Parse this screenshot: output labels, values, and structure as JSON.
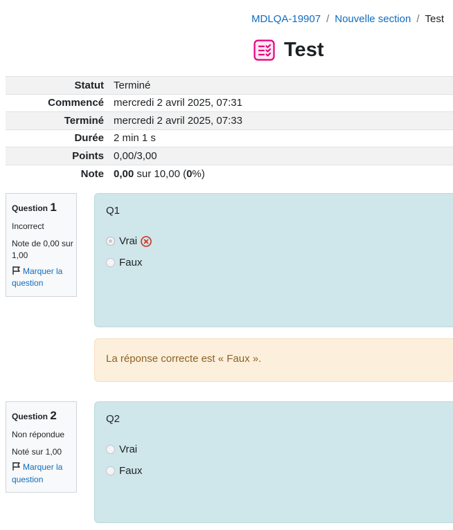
{
  "breadcrumb": {
    "items": [
      "MDLQA-19907",
      "Nouvelle section",
      "Test"
    ],
    "sep": "/"
  },
  "page": {
    "title": "Test",
    "icon": "quiz-icon",
    "accent": "#e6007e"
  },
  "summary": {
    "rows": [
      {
        "label": "Statut",
        "value": "Terminé"
      },
      {
        "label": "Commencé",
        "value": "mercredi 2 avril 2025, 07:31"
      },
      {
        "label": "Terminé",
        "value": "mercredi 2 avril 2025, 07:33"
      },
      {
        "label": "Durée",
        "value": "2 min 1 s"
      },
      {
        "label": "Points",
        "value": "0,00/3,00"
      }
    ],
    "note": {
      "label": "Note",
      "score": "0,00",
      "middle": " sur 10,00 (",
      "percent": "0",
      "end": "%)"
    }
  },
  "questions": [
    {
      "label": "Question",
      "number": "1",
      "state": "Incorrect",
      "grade": "Note de 0,00 sur 1,00",
      "flag": "Marquer la question",
      "text": "Q1",
      "answers": [
        {
          "text": "Vrai",
          "checked": true,
          "wrong": true
        },
        {
          "text": "Faux",
          "checked": false
        }
      ],
      "feedback": "La réponse correcte est « Faux »."
    },
    {
      "label": "Question",
      "number": "2",
      "state": "Non répondue",
      "grade": "Noté sur 1,00",
      "flag": "Marquer la question",
      "text": "Q2",
      "answers": [
        {
          "text": "Vrai",
          "checked": false
        },
        {
          "text": "Faux",
          "checked": false
        }
      ]
    }
  ],
  "colors": {
    "link": "#0f6cbf",
    "question_bg": "#cfe6ea",
    "feedback_bg": "#fcefdc",
    "feedback_text": "#8d6126",
    "wrong": "#ca3120"
  }
}
